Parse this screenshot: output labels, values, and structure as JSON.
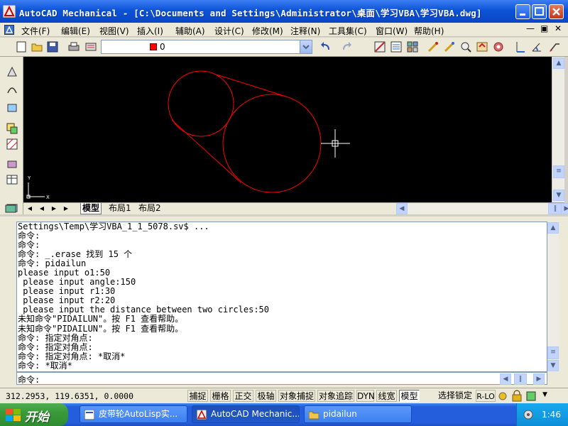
{
  "titlebar": {
    "title": "AutoCAD Mechanical - [C:\\Documents and Settings\\Administrator\\桌面\\学习VBA\\学习VBA.dwg]"
  },
  "menubar": {
    "items": [
      "文件(F)",
      "编辑(E)",
      "视图(V)",
      "插入(I)",
      "辅助(A)",
      "设计(C)",
      "修改(M)",
      "注释(N)",
      "工具集(C)",
      "窗口(W)",
      "帮助(H)"
    ]
  },
  "toolbar": {
    "layer_name": "0",
    "layer_color": "#ff0000"
  },
  "drawing": {
    "stroke_color": "#ff0000",
    "background": "#000000",
    "ucs_y_label": "Y",
    "ucs_x_label": "X"
  },
  "layout_tabs": [
    "模型",
    "布局1",
    "布局2"
  ],
  "command": {
    "history": [
      "Settings\\Temp\\学习VBA_1_1_5078.sv$ ...",
      "命令:",
      "命令:",
      "命令: _.erase 找到 15 个",
      "命令: pidailun",
      "please input o1:50",
      " please input angle:150",
      " please input r1:30",
      " please input r2:20",
      " please input the distance between two circles:50",
      "未知命令\"PIDAILUN\"。按 F1 查看帮助。",
      "未知命令\"PIDAILUN\"。按 F1 查看帮助。",
      "命令: 指定对角点:",
      "命令: 指定对角点:",
      "命令: 指定对角点: *取消*",
      "命令: *取消*"
    ],
    "prompt": "命令:"
  },
  "statusbar": {
    "coords": "312.2953, 119.6351, 0.0000",
    "toggles": [
      "捕捉",
      "栅格",
      "正交",
      "极轴",
      "对象捕捉",
      "对象追踪",
      "DYN",
      "线宽",
      "模型"
    ],
    "lock_label": "选择锁定",
    "rlo_label": "R-LO"
  },
  "taskbar": {
    "start_label": "开始",
    "tasks": [
      "皮带轮AutoLisp实...",
      "AutoCAD Mechanic...",
      "pidailun"
    ],
    "clock": "1:46"
  }
}
